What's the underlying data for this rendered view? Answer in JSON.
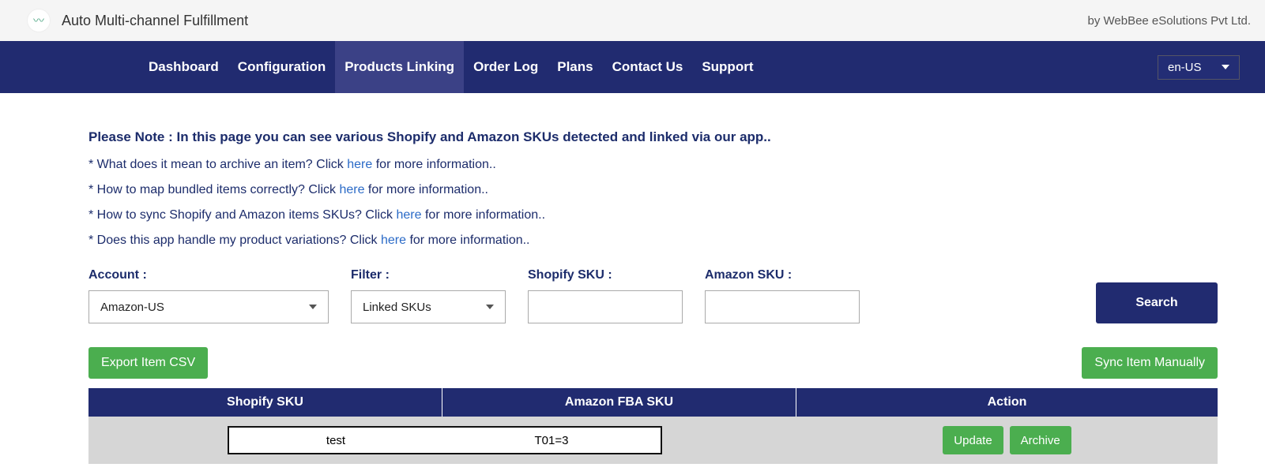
{
  "header": {
    "app_title": "Auto Multi-channel Fulfillment",
    "vendor": "by WebBee eSolutions Pvt Ltd."
  },
  "nav": {
    "items": [
      {
        "label": "Dashboard",
        "active": false
      },
      {
        "label": "Configuration",
        "active": false
      },
      {
        "label": "Products Linking",
        "active": true
      },
      {
        "label": "Order Log",
        "active": false
      },
      {
        "label": "Plans",
        "active": false
      },
      {
        "label": "Contact Us",
        "active": false
      },
      {
        "label": "Support",
        "active": false
      }
    ],
    "language": "en-US"
  },
  "notes": {
    "heading": "Please Note : In this page you can see various Shopify and Amazon SKUs detected and linked via our app..",
    "lines": [
      {
        "pre": "* What does it mean to archive an item? Click ",
        "link": "here",
        "post": " for more information.."
      },
      {
        "pre": "* How to map bundled items correctly? Click ",
        "link": "here",
        "post": " for more information.."
      },
      {
        "pre": "* How to sync Shopify and Amazon items SKUs? Click ",
        "link": "here",
        "post": " for more information.."
      },
      {
        "pre": "* Does this app handle my product variations? Click ",
        "link": "here",
        "post": " for more information.."
      }
    ]
  },
  "filters": {
    "account_label": "Account :",
    "account_value": "Amazon-US",
    "filter_label": "Filter :",
    "filter_value": "Linked SKUs",
    "shopify_label": "Shopify SKU :",
    "shopify_value": "",
    "amazon_label": "Amazon SKU :",
    "amazon_value": "",
    "search_button": "Search"
  },
  "actions": {
    "export": "Export Item CSV",
    "sync": "Sync Item Manually"
  },
  "table": {
    "headers": [
      "Shopify SKU",
      "Amazon FBA SKU",
      "Action"
    ],
    "rows": [
      {
        "shopify": "test",
        "amazon": "T01=3",
        "update": "Update",
        "archive": "Archive"
      }
    ]
  }
}
